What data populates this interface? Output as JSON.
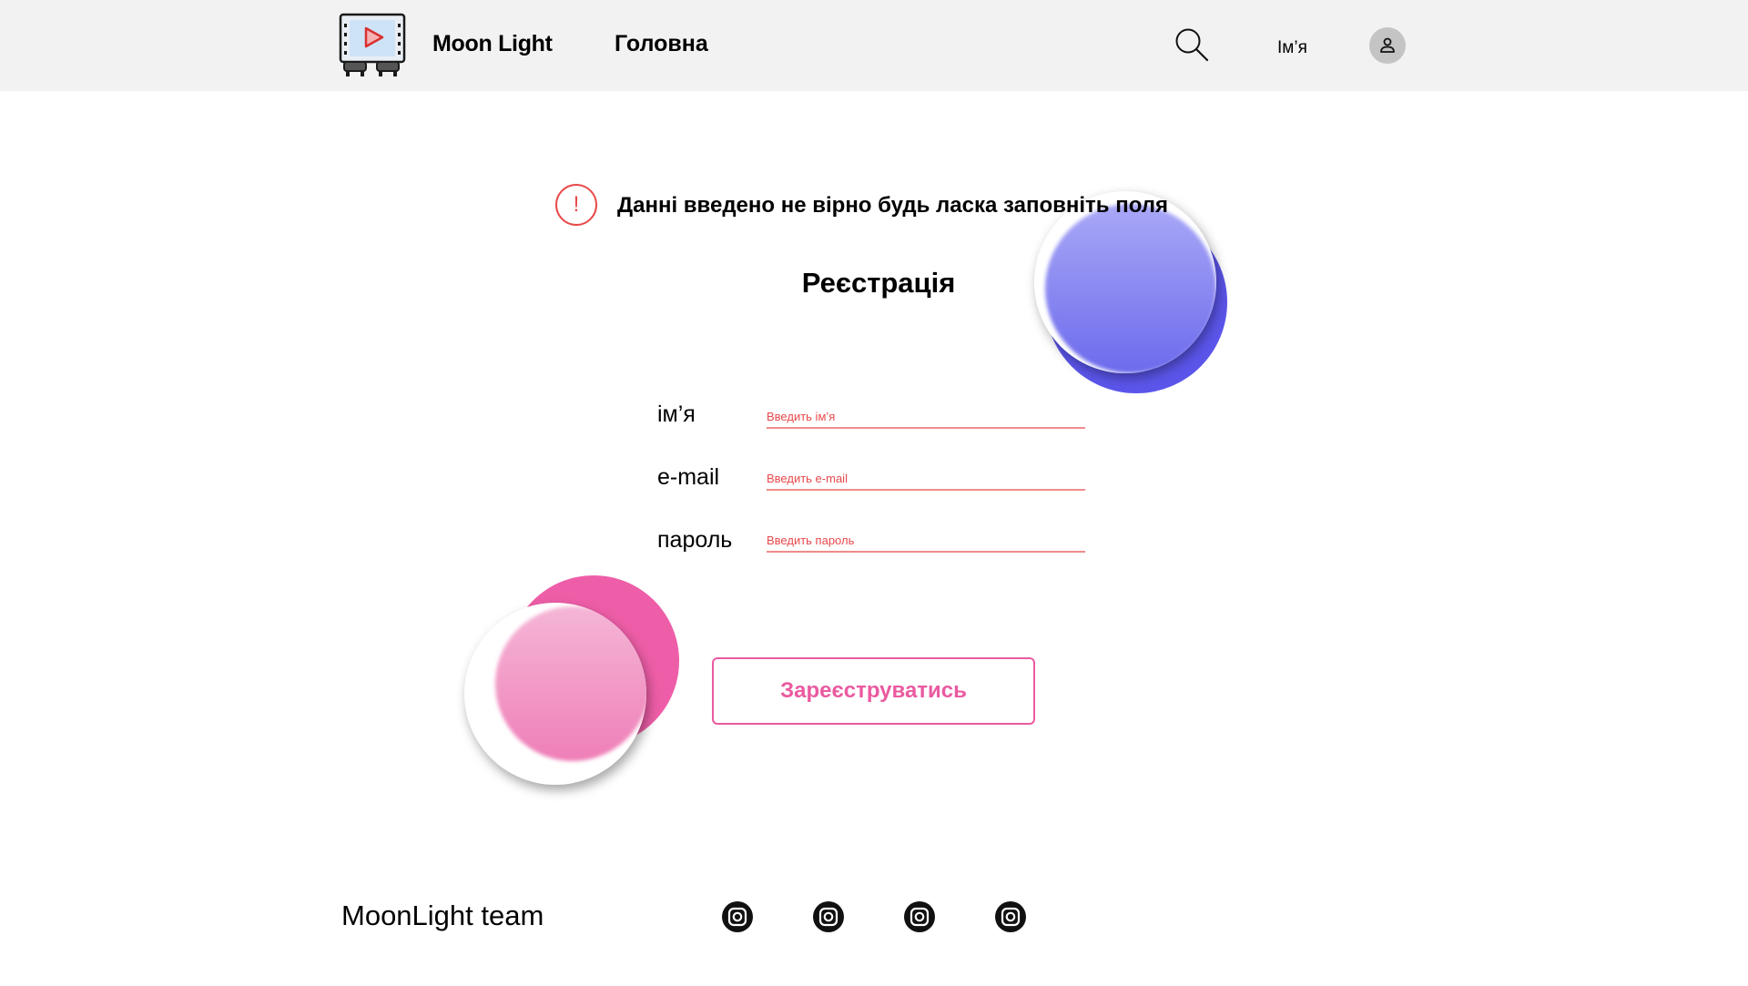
{
  "header": {
    "brand": "Moon Light",
    "nav_home": "Головна",
    "user_name": "Ім’я"
  },
  "error": {
    "message": "Данні введено не вірно будь ласка заповніть поля"
  },
  "form": {
    "title": "Реєстрація",
    "fields": [
      {
        "label": "ім’я",
        "placeholder": "Введить ім’я"
      },
      {
        "label": "e-mail",
        "placeholder": "Введить e-mail"
      },
      {
        "label": "пароль",
        "placeholder": "Введить пароль"
      }
    ],
    "submit_label": "Зареєструватись"
  },
  "footer": {
    "team": "MoonLight team",
    "social_icons": [
      "instagram-icon",
      "instagram-icon",
      "instagram-icon",
      "instagram-icon"
    ]
  },
  "colors": {
    "header_bg": "#f2f2f2",
    "error": "#e84a4a",
    "accent_pink": "#ea5aa0",
    "accent_blue": "#5b55ea"
  }
}
